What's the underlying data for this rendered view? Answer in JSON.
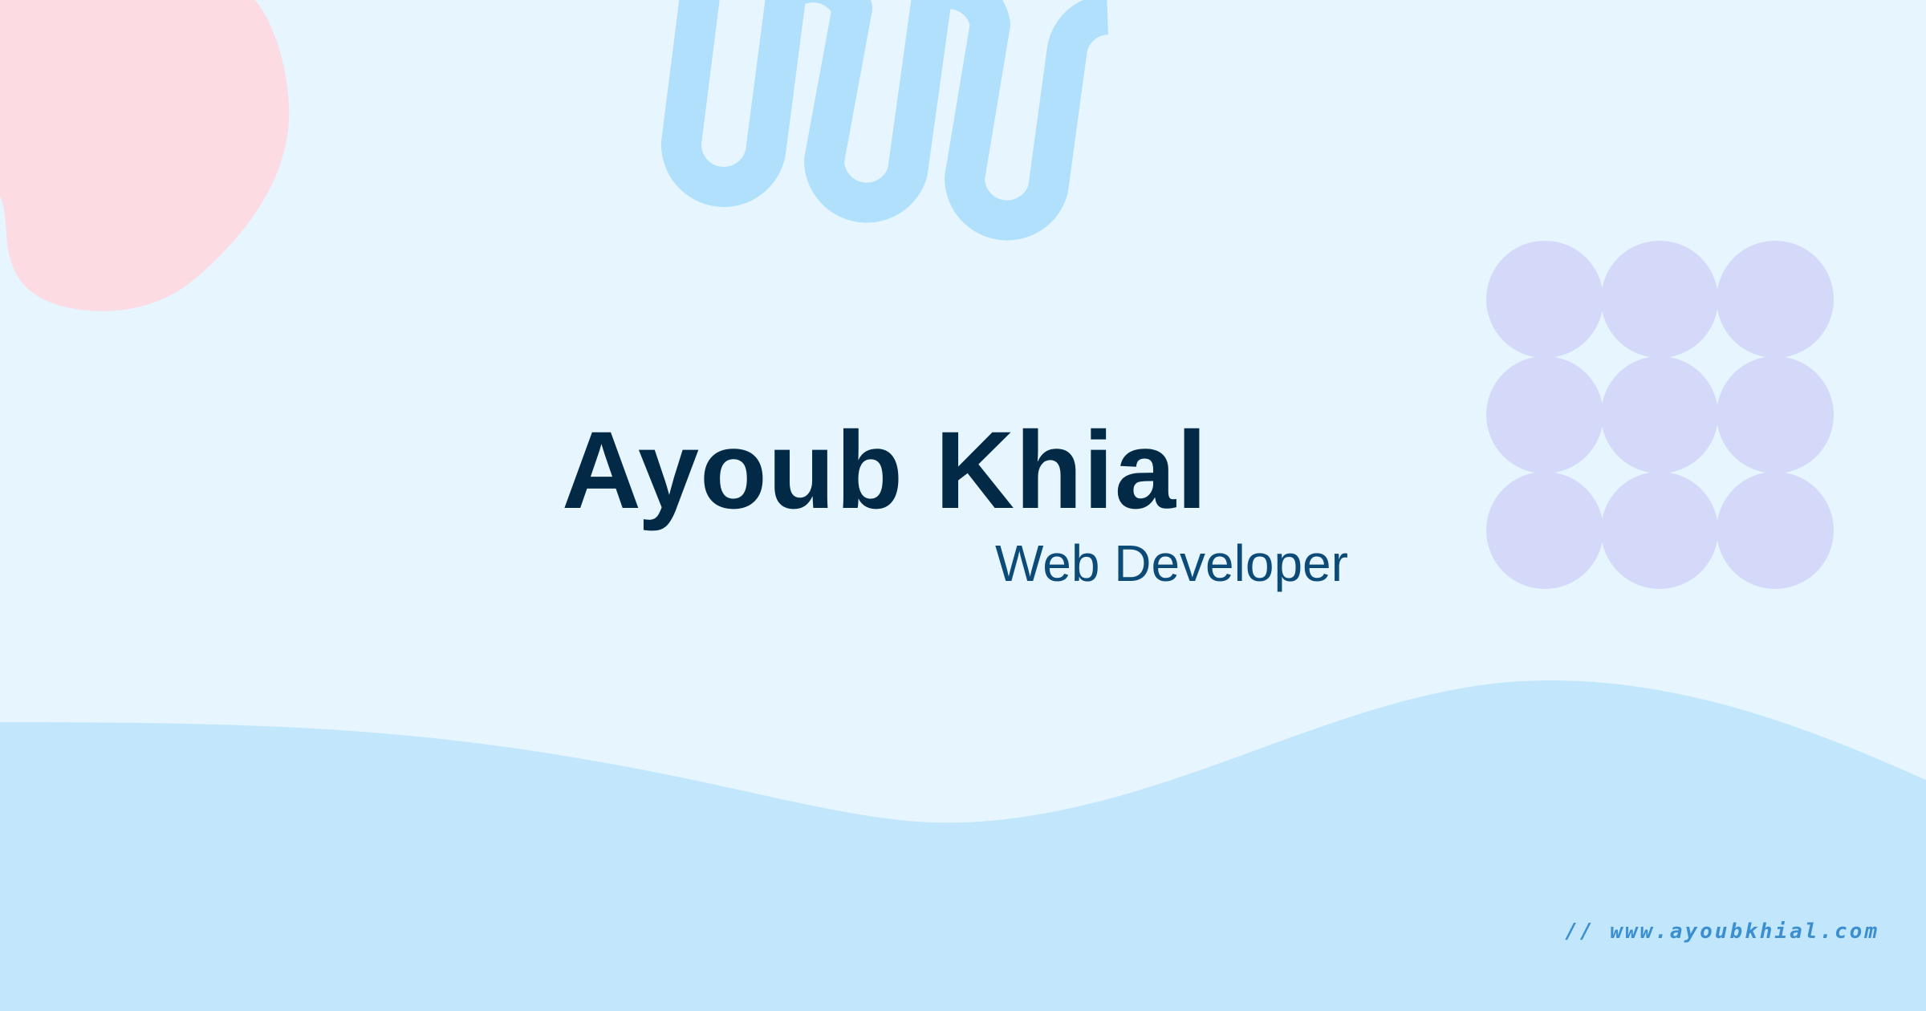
{
  "profile": {
    "name": "Ayoub Khial",
    "role": "Web Developer",
    "website": "// www.ayoubkhial.com"
  },
  "colors": {
    "background": "#e6f5fe",
    "wave": "#c2e7fd",
    "pink_blob": "#fddbe3",
    "squiggle": "#b0e0fc",
    "circles": "#d4d9fa",
    "name_text": "#022a46",
    "role_text": "#0c4a78",
    "website_text": "#3b8fd0"
  }
}
